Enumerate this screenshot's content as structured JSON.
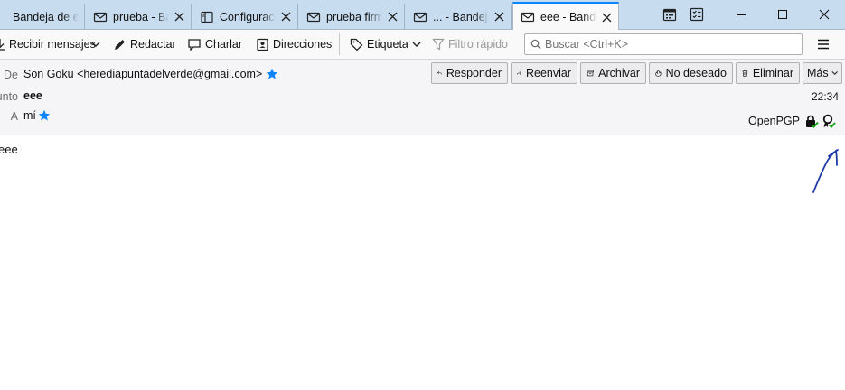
{
  "tabs": [
    {
      "label": "Bandeja de entrada",
      "icon": "folder-icon"
    },
    {
      "label": "prueba - Bandeja",
      "icon": "mail-icon"
    },
    {
      "label": "Configuración",
      "icon": "settings-page-icon"
    },
    {
      "label": "prueba firmada",
      "icon": "mail-icon"
    },
    {
      "label": "... - Bandeja",
      "icon": "mail-icon"
    },
    {
      "label": "eee - Bandeja",
      "icon": "mail-icon",
      "active": true
    }
  ],
  "toolbar": {
    "get_messages": "Recibir mensajes",
    "compose": "Redactar",
    "chat": "Charlar",
    "address_book": "Direcciones",
    "tag": "Etiqueta",
    "quick_filter": "Filtro rápido",
    "search_placeholder": "Buscar <Ctrl+K>"
  },
  "header": {
    "from_label": "De",
    "from_value": "Son Goku <herediapuntadelverde@gmail.com>",
    "subject_label": "Asunto",
    "subject_value": "eee",
    "to_label": "A",
    "to_value": "mí",
    "time": "22:34",
    "security_label": "OpenPGP",
    "buttons": {
      "reply": "Responder",
      "forward": "Reenviar",
      "archive": "Archivar",
      "junk": "No deseado",
      "delete": "Eliminar",
      "more": "Más"
    }
  },
  "body": {
    "text": "eee"
  },
  "colors": {
    "tabbar": "#c7dcef",
    "accent": "#0a84ff",
    "star": "#0a84ff",
    "annotation": "#1e3aa8",
    "verified": "#12a312"
  }
}
